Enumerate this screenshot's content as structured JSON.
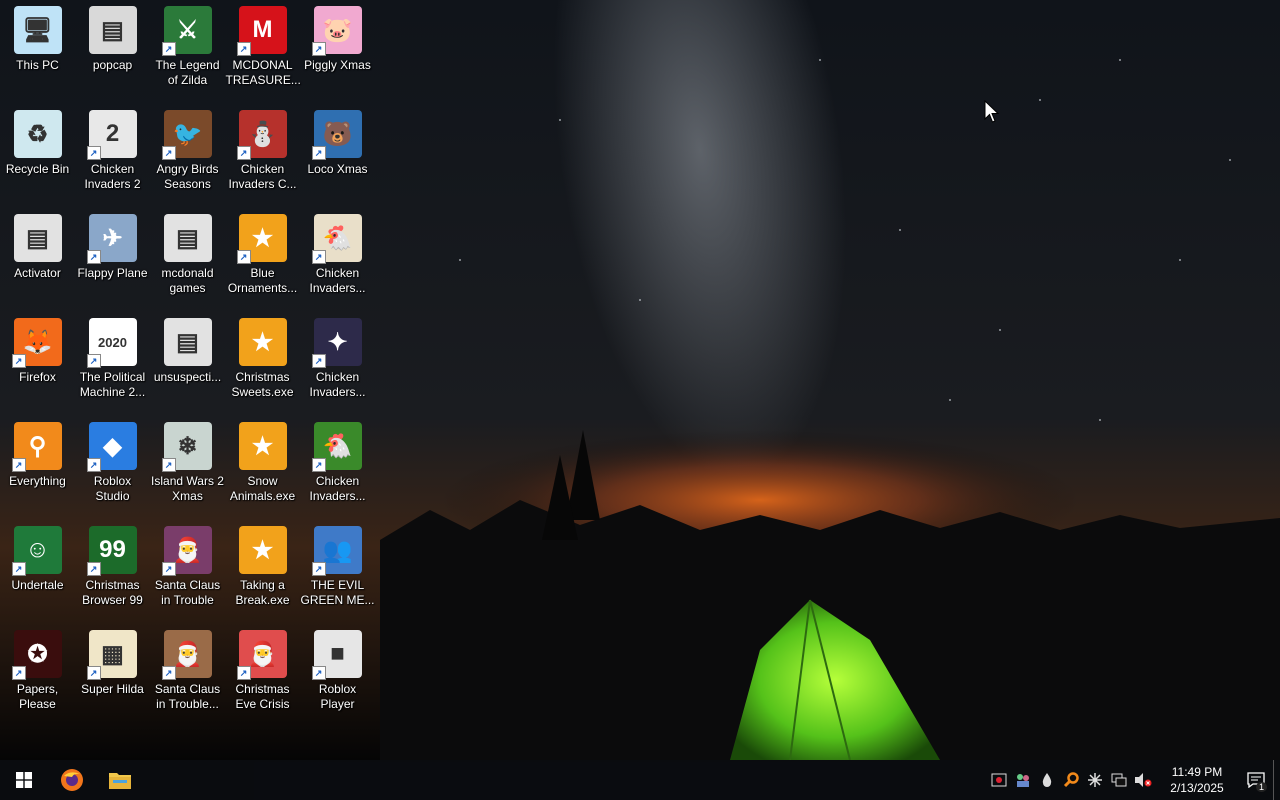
{
  "desktop": {
    "icons": [
      {
        "label": "This PC",
        "glyph": "🖥",
        "bg": "#bfe3f7",
        "shortcut": false
      },
      {
        "label": "popcap",
        "glyph": "▤",
        "bg": "#d9d9d9",
        "shortcut": false
      },
      {
        "label": "The Legend\nof Zilda",
        "glyph": "⚔",
        "bg": "#2b7a3a",
        "shortcut": true
      },
      {
        "label": "MCDONAL\nTREASURE...",
        "glyph": "M",
        "bg": "#d6121a",
        "shortcut": true
      },
      {
        "label": "Piggly Xmas",
        "glyph": "🐷",
        "bg": "#f1a9d0",
        "shortcut": true
      },
      {
        "label": "Recycle Bin",
        "glyph": "♻",
        "bg": "#cfe8ef",
        "shortcut": false
      },
      {
        "label": "Chicken\nInvaders 2",
        "glyph": "2",
        "bg": "#e8e8e8",
        "shortcut": true
      },
      {
        "label": "Angry Birds\nSeasons",
        "glyph": "🐦",
        "bg": "#7b4a2a",
        "shortcut": true
      },
      {
        "label": "Chicken\nInvaders C...",
        "glyph": "⛄",
        "bg": "#b6312c",
        "shortcut": true
      },
      {
        "label": "Loco Xmas",
        "glyph": "🐻",
        "bg": "#2f6fb1",
        "shortcut": true
      },
      {
        "label": "Activator",
        "glyph": "▤",
        "bg": "#e2e2e2",
        "shortcut": false
      },
      {
        "label": "Flappy Plane",
        "glyph": "✈",
        "bg": "#8aa7c9",
        "shortcut": true
      },
      {
        "label": "mcdonald\ngames",
        "glyph": "▤",
        "bg": "#e2e2e2",
        "shortcut": false
      },
      {
        "label": "Blue\nOrnaments...",
        "glyph": "★",
        "bg": "#f2a21b",
        "shortcut": true
      },
      {
        "label": "Chicken\nInvaders...",
        "glyph": "🐔",
        "bg": "#e9dfc9",
        "shortcut": true
      },
      {
        "label": "Firefox",
        "glyph": "🦊",
        "bg": "#f26a1b",
        "shortcut": true
      },
      {
        "label": "The Political\nMachine 2...",
        "glyph": "2020",
        "bg": "#ffffff",
        "shortcut": true
      },
      {
        "label": "unsuspecti...",
        "glyph": "▤",
        "bg": "#e2e2e2",
        "shortcut": false
      },
      {
        "label": "Christmas\nSweets.exe",
        "glyph": "★",
        "bg": "#f2a21b",
        "shortcut": false
      },
      {
        "label": "Chicken\nInvaders...",
        "glyph": "✦",
        "bg": "#2d2a4a",
        "shortcut": true
      },
      {
        "label": "Everything",
        "glyph": "⚲",
        "bg": "#f28a1b",
        "shortcut": true
      },
      {
        "label": "Roblox\nStudio",
        "glyph": "◆",
        "bg": "#2a7de1",
        "shortcut": true
      },
      {
        "label": "Island Wars 2\nXmas",
        "glyph": "❄",
        "bg": "#c9d5d0",
        "shortcut": true
      },
      {
        "label": "Snow\nAnimals.exe",
        "glyph": "★",
        "bg": "#f2a21b",
        "shortcut": false
      },
      {
        "label": "Chicken\nInvaders...",
        "glyph": "🐔",
        "bg": "#3a8a2a",
        "shortcut": true
      },
      {
        "label": "Undertale",
        "glyph": "☺",
        "bg": "#1f7a3a",
        "shortcut": true
      },
      {
        "label": "Christmas\nBrowser 99",
        "glyph": "99",
        "bg": "#1c6b2a",
        "shortcut": true
      },
      {
        "label": "Santa Claus\nin Trouble",
        "glyph": "🎅",
        "bg": "#7a3d6a",
        "shortcut": true
      },
      {
        "label": "Taking a\nBreak.exe",
        "glyph": "★",
        "bg": "#f2a21b",
        "shortcut": false
      },
      {
        "label": "THE EVIL\nGREEN ME...",
        "glyph": "👥",
        "bg": "#3f7ac8",
        "shortcut": true
      },
      {
        "label": "Papers,\nPlease",
        "glyph": "✪",
        "bg": "#3a0d0d",
        "shortcut": true
      },
      {
        "label": "Super Hilda",
        "glyph": "▦",
        "bg": "#f0e6c8",
        "shortcut": true
      },
      {
        "label": "Santa Claus\nin Trouble...",
        "glyph": "🎅",
        "bg": "#9a6b48",
        "shortcut": true
      },
      {
        "label": "Christmas\nEve Crisis",
        "glyph": "🎅",
        "bg": "#e04d4d",
        "shortcut": true
      },
      {
        "label": "Roblox Player",
        "glyph": "■",
        "bg": "#e6e6e6",
        "shortcut": true
      }
    ]
  },
  "taskbar": {
    "start_icon": "windows-logo-icon",
    "pinned": [
      {
        "name": "firefox-taskbar-button",
        "icon": "firefox-icon"
      },
      {
        "name": "file-explorer-taskbar-button",
        "icon": "folder-icon"
      }
    ],
    "tray_icons": [
      "shield-app-icon",
      "people-app-icon",
      "drop-icon",
      "search-orange-icon",
      "asterisk-icon",
      "network-icon",
      "volume-muted-icon"
    ],
    "time": "11:49 PM",
    "date": "2/13/2025",
    "notification_count": "1"
  }
}
